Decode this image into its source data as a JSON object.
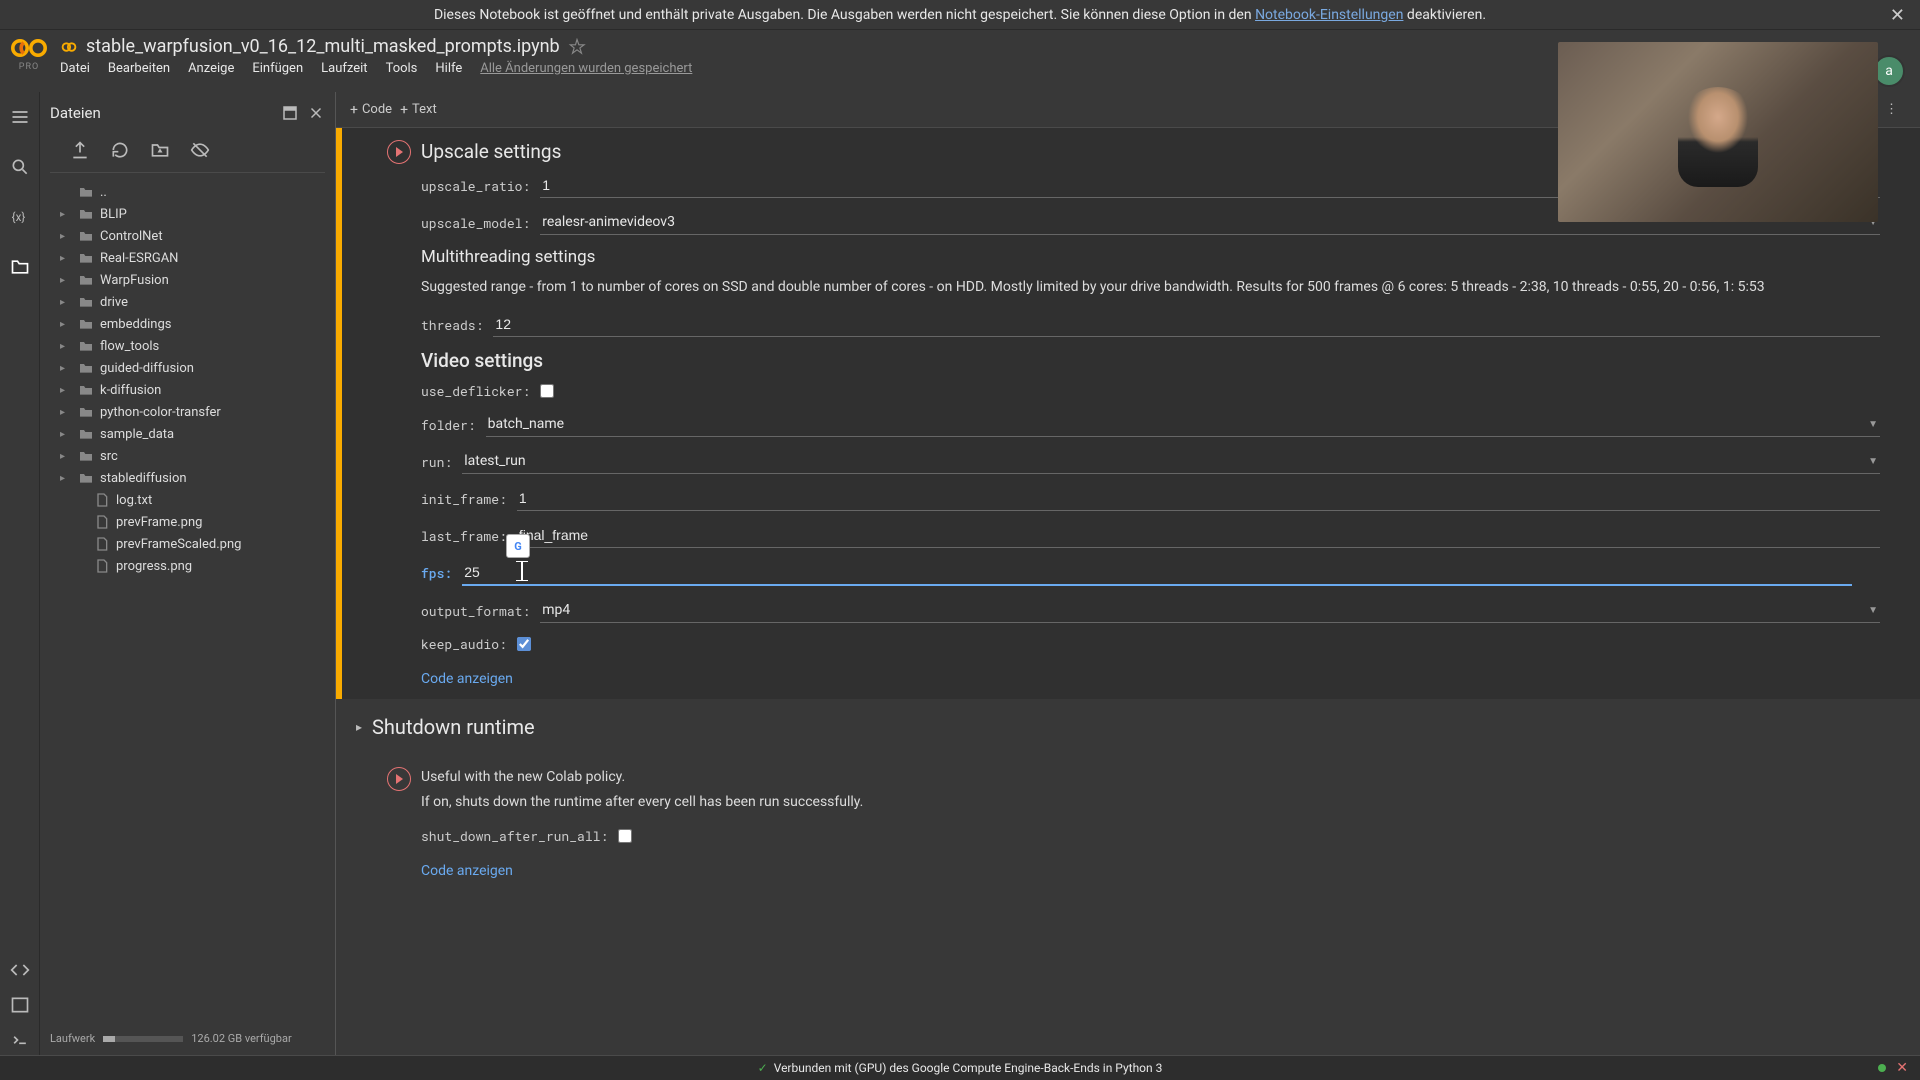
{
  "banner": {
    "text_before": "Dieses Notebook ist geöffnet und enthält private Ausgaben. Die Ausgaben werden nicht gespeichert. Sie können diese Option in den ",
    "link": "Notebook-Einstellungen",
    "text_after": " deaktivieren."
  },
  "header": {
    "logo_sub": "PRO",
    "title": "stable_warpfusion_v0_16_12_multi_masked_prompts.ipynb",
    "menus": [
      "Datei",
      "Bearbeiten",
      "Anzeige",
      "Einfügen",
      "Laufzeit",
      "Tools",
      "Hilfe"
    ],
    "save_status": "Alle Änderungen wurden gespeichert",
    "avatar_letter": "a"
  },
  "toolbar": {
    "code": "Code",
    "text": "Text"
  },
  "sidebar": {
    "title": "Dateien",
    "parent": "..",
    "folders": [
      "BLIP",
      "ControlNet",
      "Real-ESRGAN",
      "WarpFusion",
      "drive",
      "embeddings",
      "flow_tools",
      "guided-diffusion",
      "k-diffusion",
      "python-color-transfer",
      "sample_data",
      "src",
      "stablediffusion"
    ],
    "files": [
      "log.txt",
      "prevFrame.png",
      "prevFrameScaled.png",
      "progress.png"
    ],
    "disk_label": "Laufwerk",
    "disk_free": "126.02 GB verfügbar"
  },
  "content": {
    "upscale": {
      "title": "Upscale settings",
      "ratio_label": "upscale_ratio:",
      "ratio_value": "1",
      "model_label": "upscale_model:",
      "model_value": "realesr-animevideov3"
    },
    "multithread": {
      "title": "Multithreading settings",
      "desc": "Suggested range - from 1 to number of cores on SSD and double number of cores - on HDD. Mostly limited by your drive bandwidth. Results for 500 frames @ 6 cores: 5 threads - 2:38, 10 threads - 0:55, 20 - 0:56, 1: 5:53",
      "threads_label": "threads:",
      "threads_value": "12"
    },
    "video": {
      "title": "Video settings",
      "deflicker_label": "use_deflicker:",
      "folder_label": "folder:",
      "folder_value": "batch_name",
      "run_label": "run:",
      "run_value": "latest_run",
      "init_label": "init_frame:",
      "init_value": "1",
      "last_label": "last_frame:",
      "last_value": "final_frame",
      "fps_label": "fps:",
      "fps_value": "25",
      "format_label": "output_format:",
      "format_value": "mp4",
      "audio_label": "keep_audio:",
      "show_code": "Code anzeigen"
    },
    "shutdown": {
      "title": "Shutdown runtime",
      "p1": "Useful with the new Colab policy.",
      "p2": "If on, shuts down the runtime after every cell has been run successfully.",
      "flag_label": "shut_down_after_run_all:",
      "show_code": "Code anzeigen"
    }
  },
  "footer": {
    "status": "Verbunden mit (GPU) des Google Compute Engine-Back-Ends in Python 3"
  }
}
